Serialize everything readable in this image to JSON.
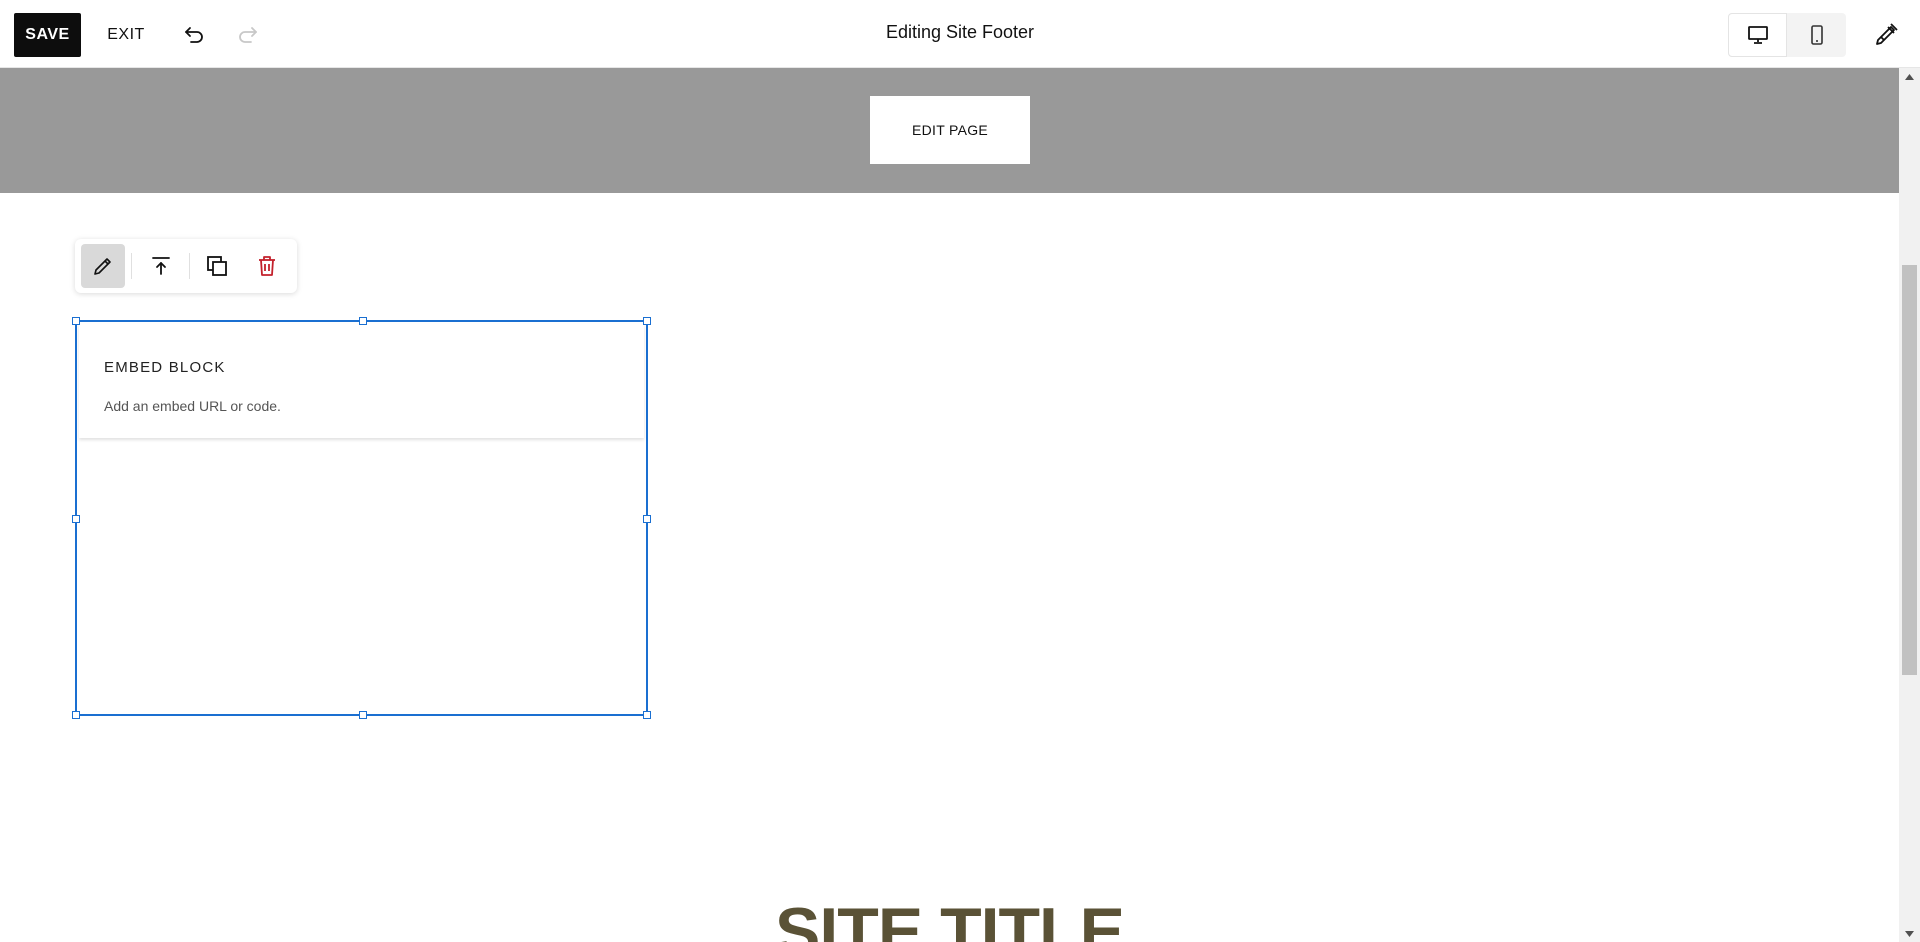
{
  "toolbar": {
    "save_label": "SAVE",
    "exit_label": "EXIT",
    "title": "Editing Site Footer",
    "undo_icon": "undo-icon",
    "redo_icon": "redo-icon",
    "device_options": [
      "desktop-icon",
      "mobile-icon"
    ],
    "active_device": "desktop",
    "design_icon": "paintbrush-icon"
  },
  "header": {
    "edit_page_label": "EDIT PAGE",
    "background_color": "#999999"
  },
  "block_toolbar": {
    "items": [
      "pencil-icon",
      "move-to-top-icon",
      "duplicate-icon",
      "trash-icon"
    ],
    "delete_color": "#c3212c"
  },
  "embed_block": {
    "title": "EMBED BLOCK",
    "description": "Add an embed URL or code.",
    "selection_color": "#1a6fd1"
  },
  "footer": {
    "site_title": "SITE TITLE",
    "site_title_color": "#5a5236"
  }
}
